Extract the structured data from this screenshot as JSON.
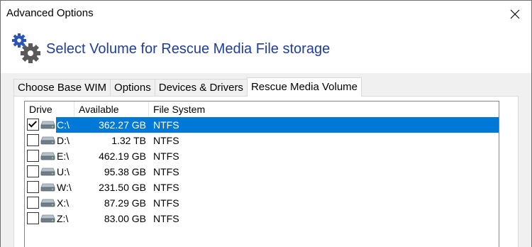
{
  "window": {
    "title": "Advanced Options",
    "close_icon": "close-icon"
  },
  "header": {
    "title": "Select Volume for Rescue Media File storage",
    "icon": "gears-icon"
  },
  "tabs": [
    {
      "label": "Choose Base WIM",
      "active": false
    },
    {
      "label": "Options",
      "active": false
    },
    {
      "label": "Devices & Drivers",
      "active": false
    },
    {
      "label": "Rescue Media Volume",
      "active": true
    }
  ],
  "columns": {
    "drive": "Drive",
    "available_space": "Available Space",
    "file_system": "File System"
  },
  "drives": [
    {
      "drive": "C:\\",
      "available_space": "362.27 GB",
      "file_system": "NTFS",
      "checked": true,
      "selected": true
    },
    {
      "drive": "D:\\",
      "available_space": "1.32 TB",
      "file_system": "NTFS",
      "checked": false,
      "selected": false
    },
    {
      "drive": "E:\\",
      "available_space": "462.19 GB",
      "file_system": "NTFS",
      "checked": false,
      "selected": false
    },
    {
      "drive": "U:\\",
      "available_space": "95.38 GB",
      "file_system": "NTFS",
      "checked": false,
      "selected": false
    },
    {
      "drive": "W:\\",
      "available_space": "231.50 GB",
      "file_system": "NTFS",
      "checked": false,
      "selected": false
    },
    {
      "drive": "X:\\",
      "available_space": "87.29 GB",
      "file_system": "NTFS",
      "checked": false,
      "selected": false
    },
    {
      "drive": "Z:\\",
      "available_space": "83.00 GB",
      "file_system": "NTFS",
      "checked": false,
      "selected": false
    }
  ],
  "colors": {
    "selection": "#0078d7",
    "header_text": "#1f3d9d",
    "gear": "#2a55b5"
  }
}
